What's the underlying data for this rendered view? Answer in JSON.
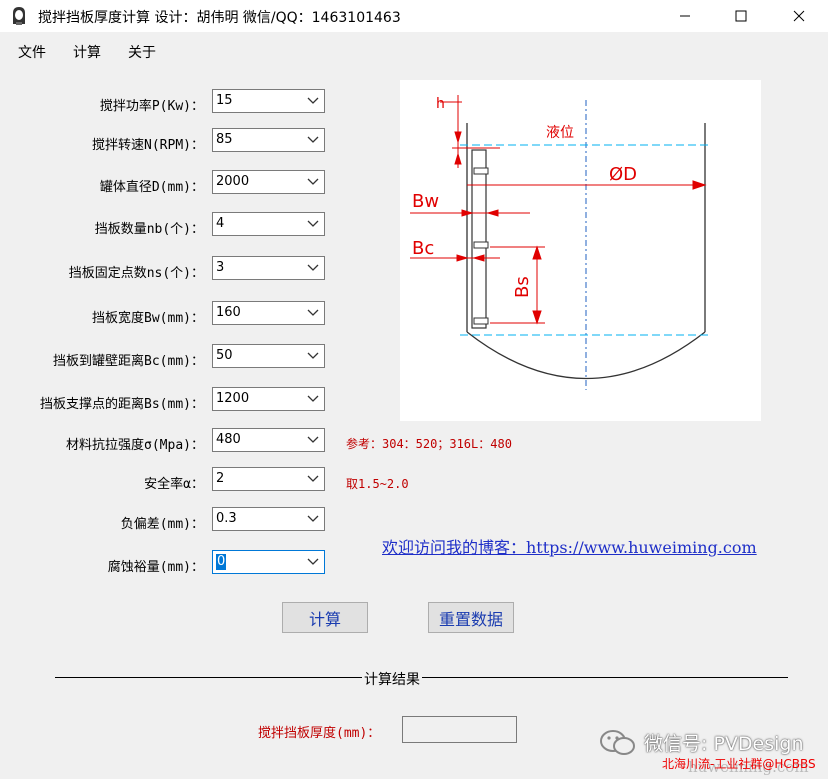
{
  "window": {
    "title": "搅拌挡板厚度计算   设计：胡伟明   微信/QQ：1463101463",
    "icons": [
      "app-icon",
      "minimize-icon",
      "maximize-icon",
      "close-icon"
    ]
  },
  "menu": {
    "items": [
      "文件",
      "计算",
      "关于"
    ]
  },
  "form": {
    "fields": [
      {
        "label": "搅拌功率P(Kw)：",
        "value": "15"
      },
      {
        "label": "搅拌转速N(RPM)：",
        "value": "85"
      },
      {
        "label": "罐体直径D(mm)：",
        "value": "2000"
      },
      {
        "label": "挡板数量nb(个)：",
        "value": "4"
      },
      {
        "label": "挡板固定点数ns(个)：",
        "value": "3"
      },
      {
        "label": "挡板宽度Bw(mm)：",
        "value": "160"
      },
      {
        "label": "挡板到罐壁距离Bc(mm)：",
        "value": "50"
      },
      {
        "label": "挡板支撑点的距离Bs(mm)：",
        "value": "1200"
      },
      {
        "label": "材料抗拉强度σ(Mpa)：",
        "value": "480"
      },
      {
        "label": "安全率α：",
        "value": "2"
      },
      {
        "label": "负偏差(mm)：",
        "value": "0.3"
      },
      {
        "label": "腐蚀裕量(mm)：",
        "value": "0"
      }
    ],
    "notes": {
      "material": "参考：304：520；316L：480",
      "safety": "取1.5~2.0"
    }
  },
  "blog_link": "欢迎访问我的博客：https://www.huweiming.com",
  "buttons": {
    "calculate": "计算",
    "reset": "重置数据"
  },
  "results": {
    "section_title": "计算结果",
    "thickness_label": "搅拌挡板厚度(mm)：",
    "thickness_value": ""
  },
  "diagram": {
    "labels": {
      "h": "h",
      "liquid": "液位",
      "diameter": "ØD",
      "bw": "Bw",
      "bc": "Bc",
      "bs": "Bs"
    },
    "colors": {
      "dim": "#e00000",
      "liquid": "#00b0f0",
      "axis": "#2060c0",
      "vessel": "#333333"
    }
  },
  "watermark": {
    "main": "微信号: PVDesign",
    "sub": "北海川流-工业社群@HCBBS",
    "url": "huweiming.com"
  }
}
